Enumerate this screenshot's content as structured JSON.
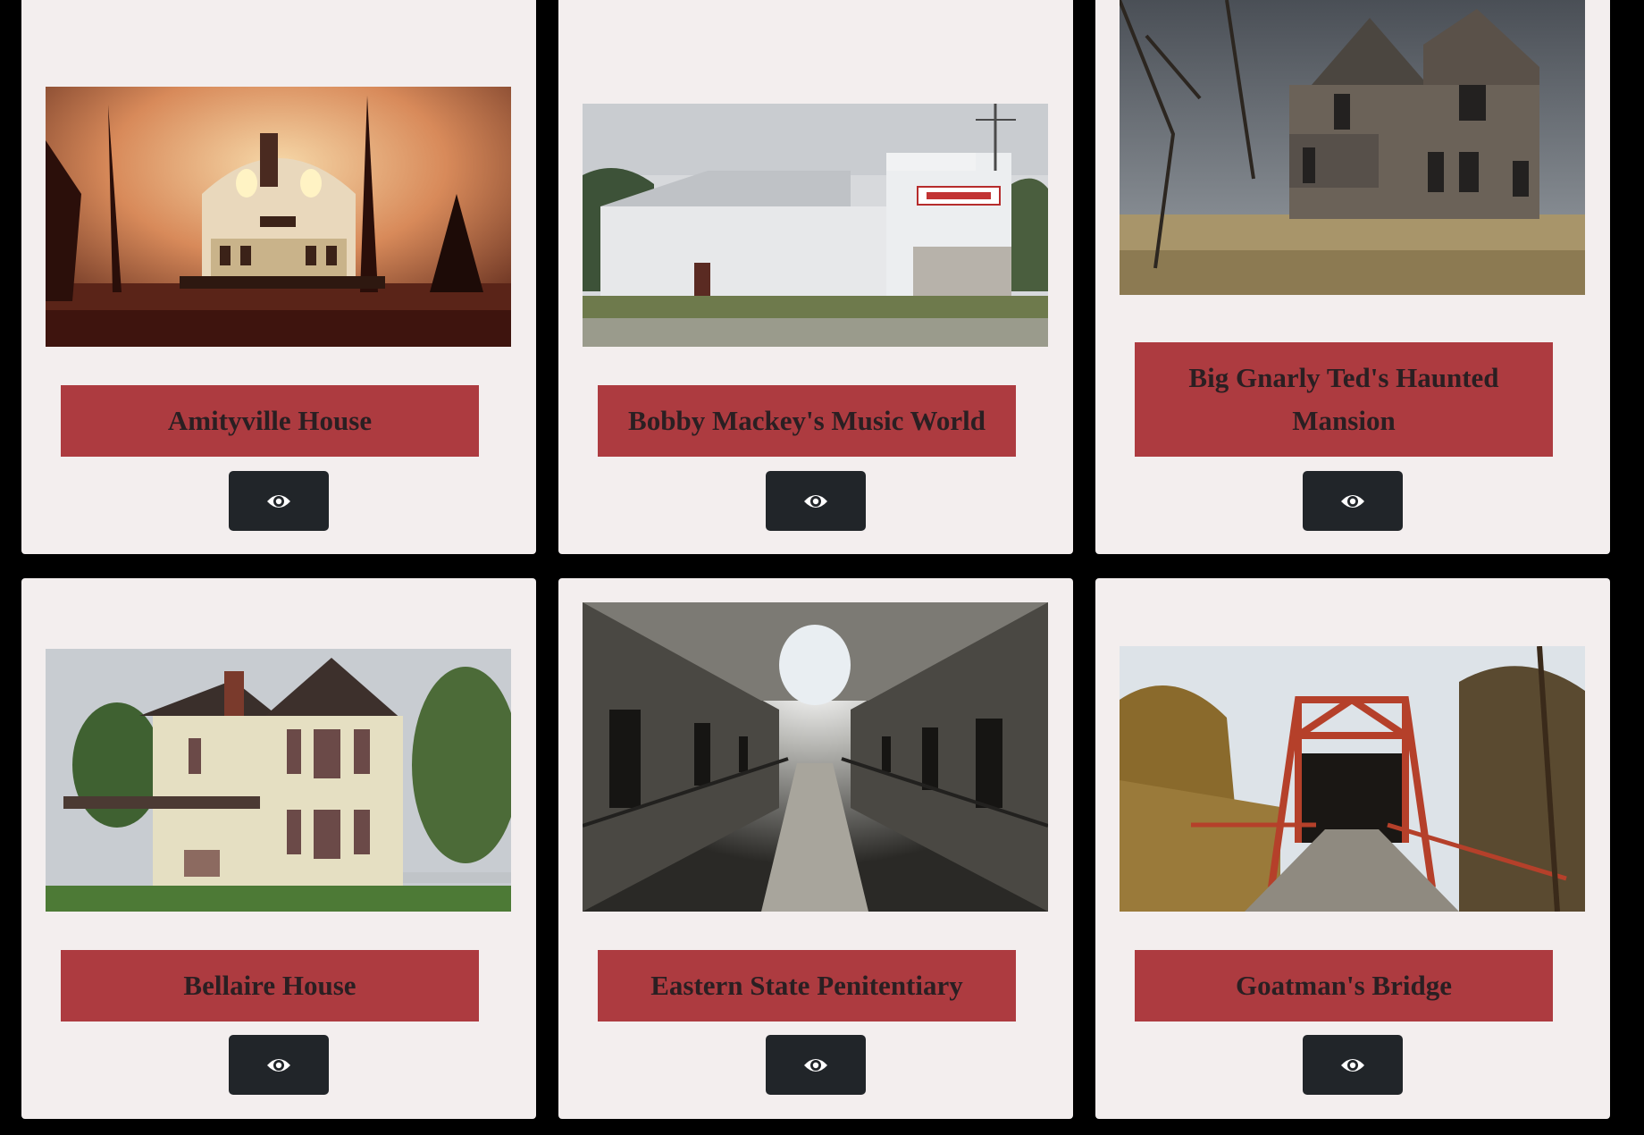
{
  "cards": [
    {
      "title": "Amityville House",
      "view_icon": "eye-icon"
    },
    {
      "title": "Bobby Mackey's Music World",
      "view_icon": "eye-icon"
    },
    {
      "title": "Big Gnarly Ted's Haunted Mansion",
      "view_icon": "eye-icon"
    },
    {
      "title": "Bellaire House",
      "view_icon": "eye-icon"
    },
    {
      "title": "Eastern State Penitentiary",
      "view_icon": "eye-icon"
    },
    {
      "title": "Goatman's Bridge",
      "view_icon": "eye-icon"
    }
  ],
  "colors": {
    "page_background": "#000000",
    "card_background": "#f3eeee",
    "title_background": "#ad3b40",
    "title_text": "#2a1f22",
    "button_background": "#212529",
    "icon_color": "#ffffff"
  }
}
